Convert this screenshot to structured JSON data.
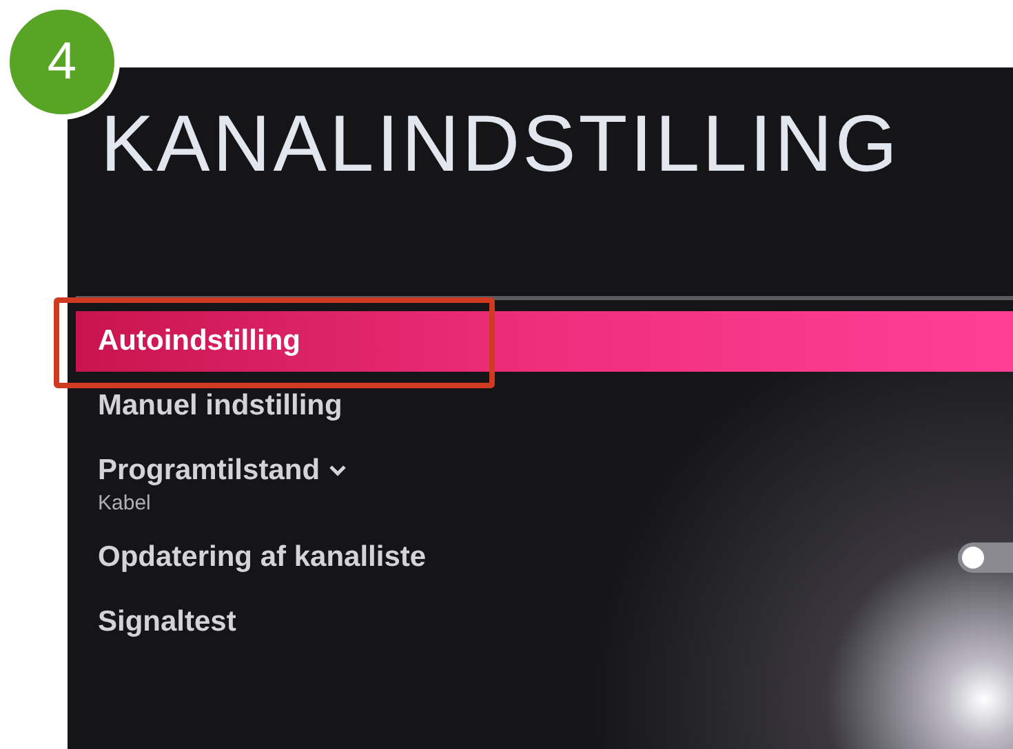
{
  "step_badge": "4",
  "title": "KANALINDSTILLING",
  "menu": [
    {
      "kind": "item",
      "label": "Autoindstilling",
      "selected": true,
      "highlighted": true
    },
    {
      "kind": "item",
      "label": "Manuel indstilling",
      "selected": false,
      "highlighted": false
    },
    {
      "kind": "dropdown",
      "label": "Programtilstand",
      "value": "Kabel",
      "selected": false,
      "highlighted": false
    },
    {
      "kind": "toggle",
      "label": "Opdatering af kanalliste",
      "on": false,
      "selected": false,
      "highlighted": false
    },
    {
      "kind": "item",
      "label": "Signaltest",
      "selected": false,
      "highlighted": false
    }
  ]
}
